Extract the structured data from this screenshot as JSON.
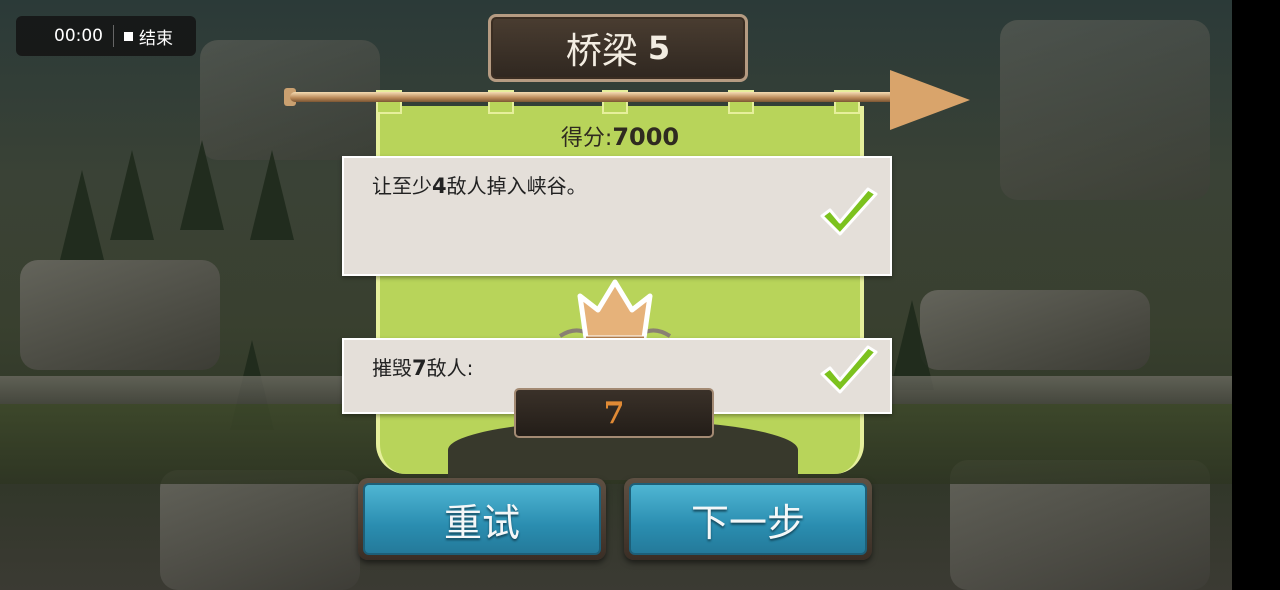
{
  "recording": {
    "time": "00:00",
    "stop_label": "结束"
  },
  "level": {
    "name": "桥梁",
    "number": "5"
  },
  "score": {
    "label": "得分:",
    "value": "7000"
  },
  "objectives": [
    {
      "text_before": "让至少",
      "count": "4",
      "text_after": "敌人掉入峡谷。",
      "completed": true
    },
    {
      "text_before": "摧毁",
      "count": "7",
      "text_after": "敌人:",
      "completed": true
    }
  ],
  "kill_counter": "7",
  "buttons": {
    "retry": "重试",
    "next": "下一步"
  },
  "colors": {
    "banner_green": "#b8d45a",
    "button_blue": "#2a8db0",
    "counter_orange": "#e08a35",
    "check_green": "#7cc21e"
  },
  "icons": {
    "check": "checkmark-icon",
    "crown": "crown-icon"
  }
}
